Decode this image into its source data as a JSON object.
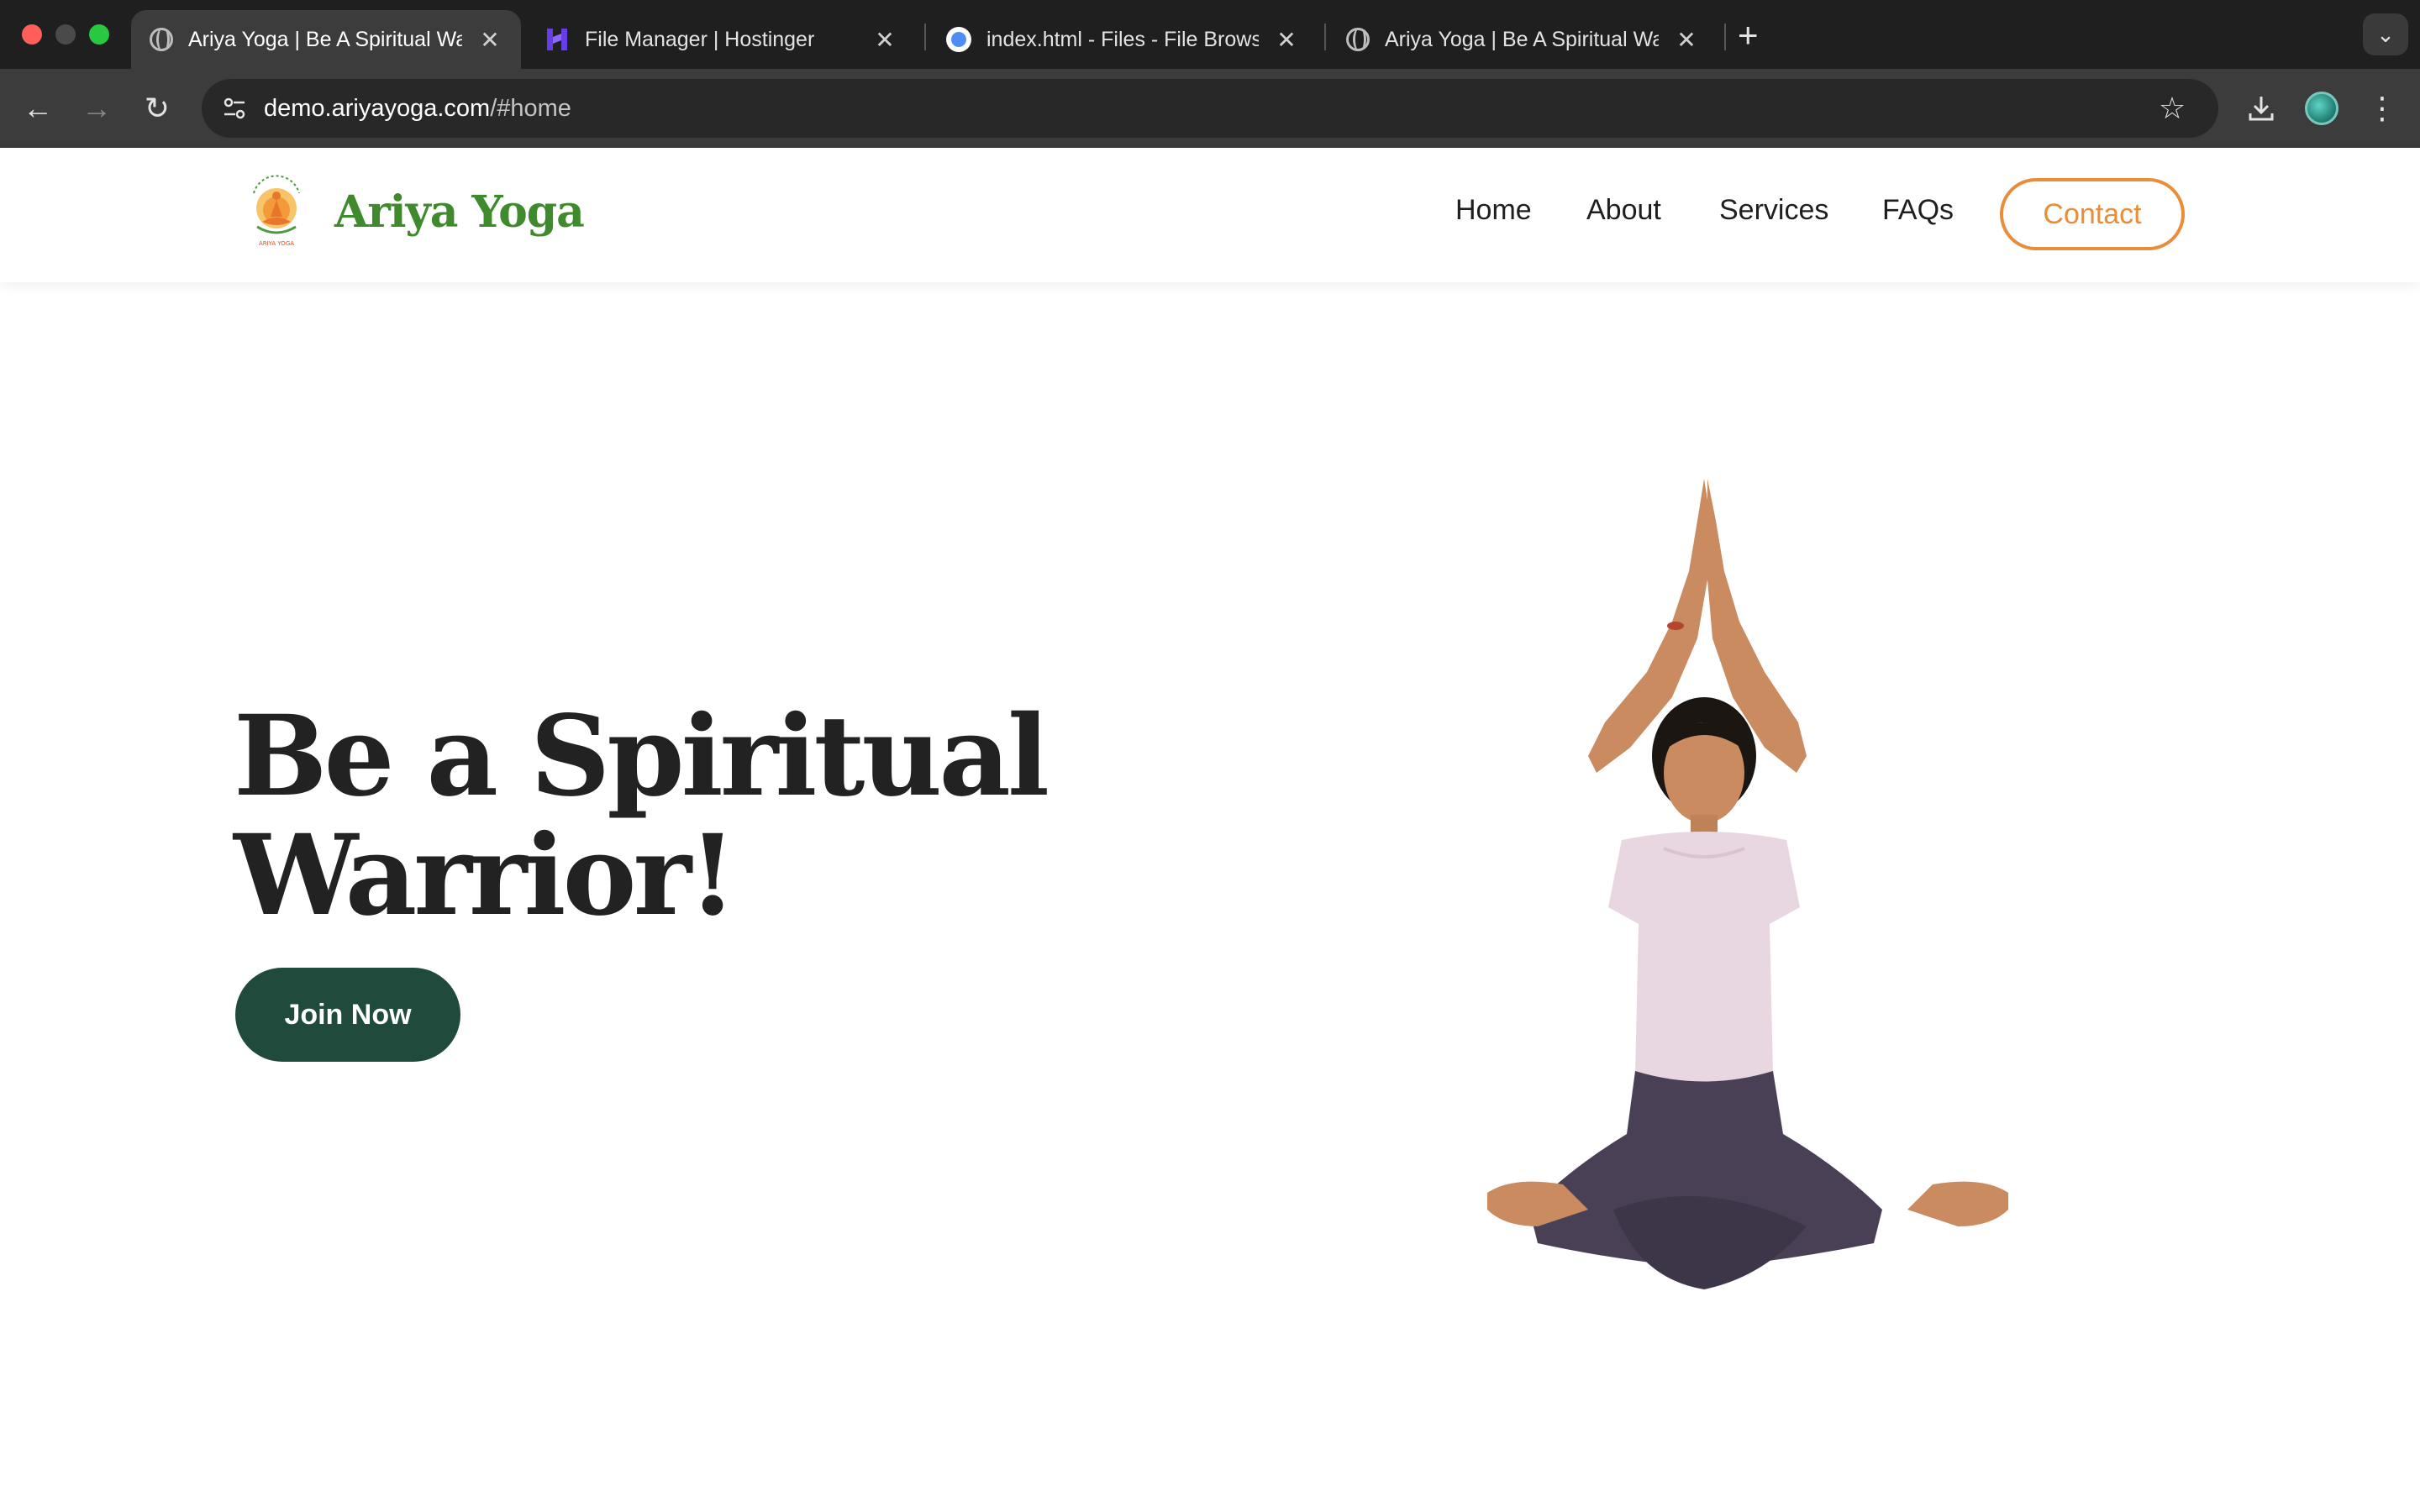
{
  "browser": {
    "tabs": [
      {
        "title": "Ariya Yoga | Be A Spiritual Wa",
        "icon": "globe-icon",
        "active": true
      },
      {
        "title": "File Manager | Hostinger",
        "icon": "hostinger-icon",
        "active": false
      },
      {
        "title": "index.html - Files - File Brows",
        "icon": "file-browser-icon",
        "active": false
      },
      {
        "title": "Ariya Yoga | Be A Spiritual Wa",
        "icon": "globe-icon",
        "active": false
      }
    ],
    "new_tab_label": "+",
    "url_host": "demo.ariyayoga.com",
    "url_path": "/#home"
  },
  "site": {
    "brand": "Ariya Yoga",
    "logo_caption": "ARIYA YOGA",
    "nav": [
      "Home",
      "About",
      "Services",
      "FAQs"
    ],
    "contact_label": "Contact",
    "hero_title_line1": "Be a Spiritual",
    "hero_title_line2": "Warrior!",
    "cta_label": "Join Now",
    "colors": {
      "brand_green": "#3f8a2c",
      "accent_orange": "#e88d3a",
      "cta_green": "#1f4a3c",
      "heading": "#222222"
    }
  }
}
